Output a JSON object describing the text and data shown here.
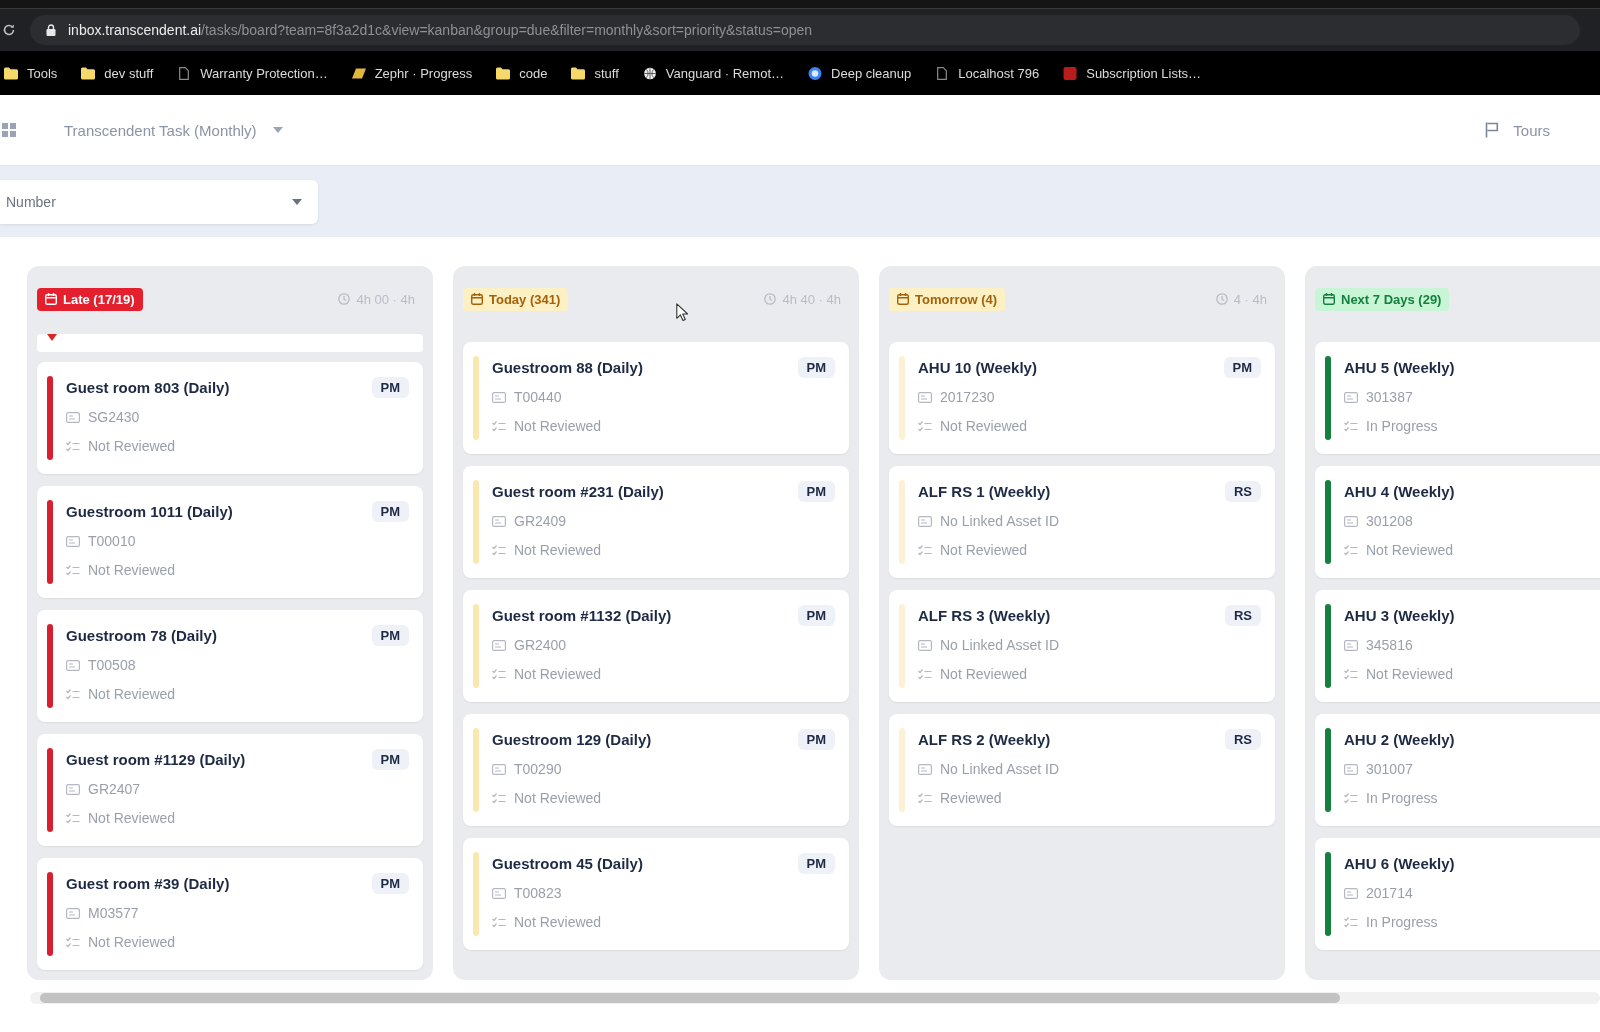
{
  "browser": {
    "url": {
      "domain": "inbox.transcendent.ai",
      "path": "/tasks/board?team=8f3a2d1c&view=kanban&group=due&filter=monthly&sort=priority&status=open"
    },
    "bookmarks": [
      {
        "kind": "folder",
        "label": "Tools"
      },
      {
        "kind": "folder",
        "label": "dev stuff"
      },
      {
        "kind": "page",
        "label": "Warranty Protection…"
      },
      {
        "kind": "diamond",
        "label": "Zephr · Progress"
      },
      {
        "kind": "folder",
        "label": "code"
      },
      {
        "kind": "folder",
        "label": "stuff"
      },
      {
        "kind": "globe",
        "label": "Vanguard · Remot…"
      },
      {
        "kind": "circle",
        "label": "Deep cleanup"
      },
      {
        "kind": "page",
        "label": "Localhost 796"
      },
      {
        "kind": "square",
        "label": "Subscription Lists…"
      }
    ]
  },
  "app_header": {
    "title": "Transcendent Task (Monthly)",
    "tours": "Tours"
  },
  "filter": {
    "value": "Number"
  },
  "columns": [
    {
      "kind": "late",
      "label": "Late (17/19)",
      "meta": "4h 00 · 4h",
      "drop_marker": true,
      "cards": [
        {
          "title": "Guest room 803 (Daily)",
          "type": "PM",
          "asset": "SG2430",
          "status": "Not Reviewed"
        },
        {
          "title": "Guestroom 1011 (Daily)",
          "type": "PM",
          "asset": "T00010",
          "status": "Not Reviewed"
        },
        {
          "title": "Guestroom 78 (Daily)",
          "type": "PM",
          "asset": "T00508",
          "status": "Not Reviewed"
        },
        {
          "title": "Guest room #1129 (Daily)",
          "type": "PM",
          "asset": "GR2407",
          "status": "Not Reviewed"
        },
        {
          "title": "Guest room #39 (Daily)",
          "type": "PM",
          "asset": "M03577",
          "status": "Not Reviewed"
        }
      ]
    },
    {
      "kind": "today",
      "label": "Today (341)",
      "meta": "4h 40 · 4h",
      "drop_marker": false,
      "cards": [
        {
          "title": "Guestroom 88 (Daily)",
          "type": "PM",
          "asset": "T00440",
          "status": "Not Reviewed"
        },
        {
          "title": "Guest room #231 (Daily)",
          "type": "PM",
          "asset": "GR2409",
          "status": "Not Reviewed"
        },
        {
          "title": "Guest room #1132 (Daily)",
          "type": "PM",
          "asset": "GR2400",
          "status": "Not Reviewed"
        },
        {
          "title": "Guestroom 129 (Daily)",
          "type": "PM",
          "asset": "T00290",
          "status": "Not Reviewed"
        },
        {
          "title": "Guestroom 45 (Daily)",
          "type": "PM",
          "asset": "T00823",
          "status": "Not Reviewed"
        }
      ]
    },
    {
      "kind": "tomorrow",
      "label": "Tomorrow (4)",
      "meta": "4 · 4h",
      "drop_marker": false,
      "cards": [
        {
          "title": "AHU 10 (Weekly)",
          "type": "PM",
          "asset": "2017230",
          "status": "Not Reviewed"
        },
        {
          "title": "ALF RS 1 (Weekly)",
          "type": "RS",
          "asset": "No Linked Asset ID",
          "status": "Not Reviewed"
        },
        {
          "title": "ALF RS 3 (Weekly)",
          "type": "RS",
          "asset": "No Linked Asset ID",
          "status": "Not Reviewed"
        },
        {
          "title": "ALF RS 2 (Weekly)",
          "type": "RS",
          "asset": "No Linked Asset ID",
          "status": "Reviewed"
        }
      ]
    },
    {
      "kind": "upcoming",
      "label": "Next 7 Days (29)",
      "drop_marker": false,
      "cards": [
        {
          "title": "AHU 5 (Weekly)",
          "asset": "301387",
          "status": "In Progress"
        },
        {
          "title": "AHU 4 (Weekly)",
          "asset": "301208",
          "status": "Not Reviewed"
        },
        {
          "title": "AHU 3 (Weekly)",
          "asset": "345816",
          "status": "Not Reviewed"
        },
        {
          "title": "AHU 2 (Weekly)",
          "asset": "301007",
          "status": "In Progress"
        },
        {
          "title": "AHU 6 (Weekly)",
          "asset": "201714",
          "status": "In Progress"
        }
      ]
    }
  ]
}
